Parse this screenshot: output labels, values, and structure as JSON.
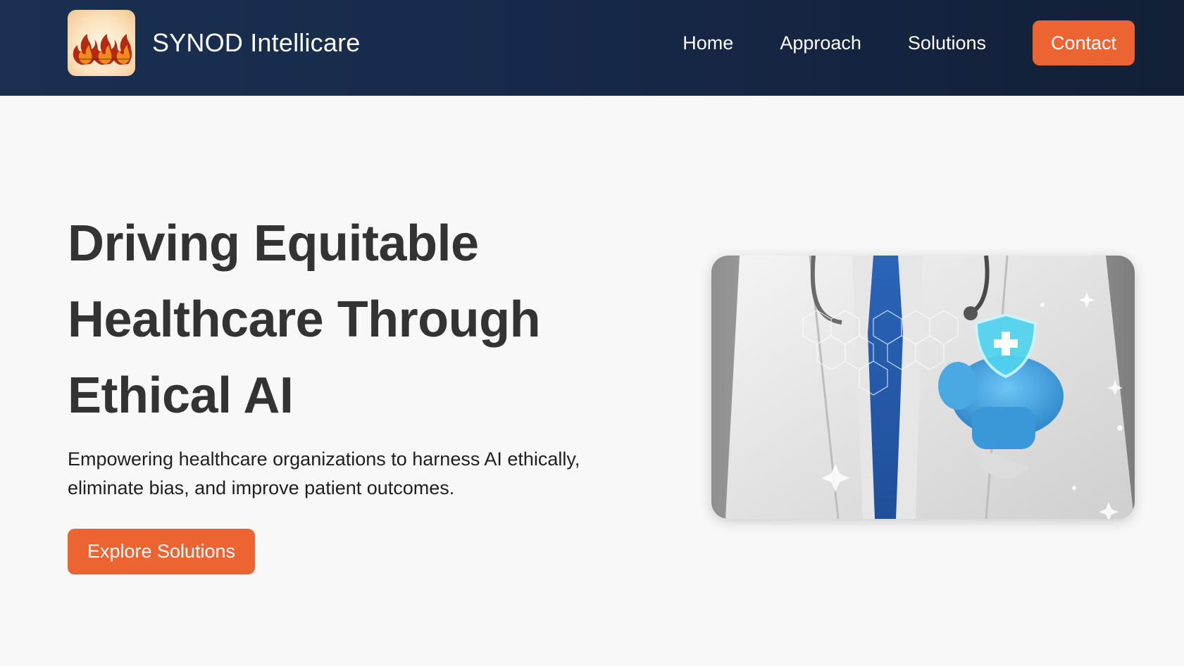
{
  "header": {
    "brand_name": "SYNOD Intellicare",
    "logo_icon": "flame-logo-icon",
    "nav": [
      {
        "label": "Home"
      },
      {
        "label": "Approach"
      },
      {
        "label": "Solutions"
      }
    ],
    "contact_label": "Contact"
  },
  "hero": {
    "title": "Driving Equitable Healthcare Through Ethical AI",
    "subtitle": "Empowering healthcare organizations to harness AI ethically, eliminate bias, and improve patient outcomes.",
    "cta_label": "Explore Solutions",
    "image_icon": "doctor-shield-image"
  },
  "colors": {
    "header_bg": "#17294a",
    "accent": "#ec6432",
    "page_bg": "#f8f8f8",
    "title_text": "#333333"
  }
}
